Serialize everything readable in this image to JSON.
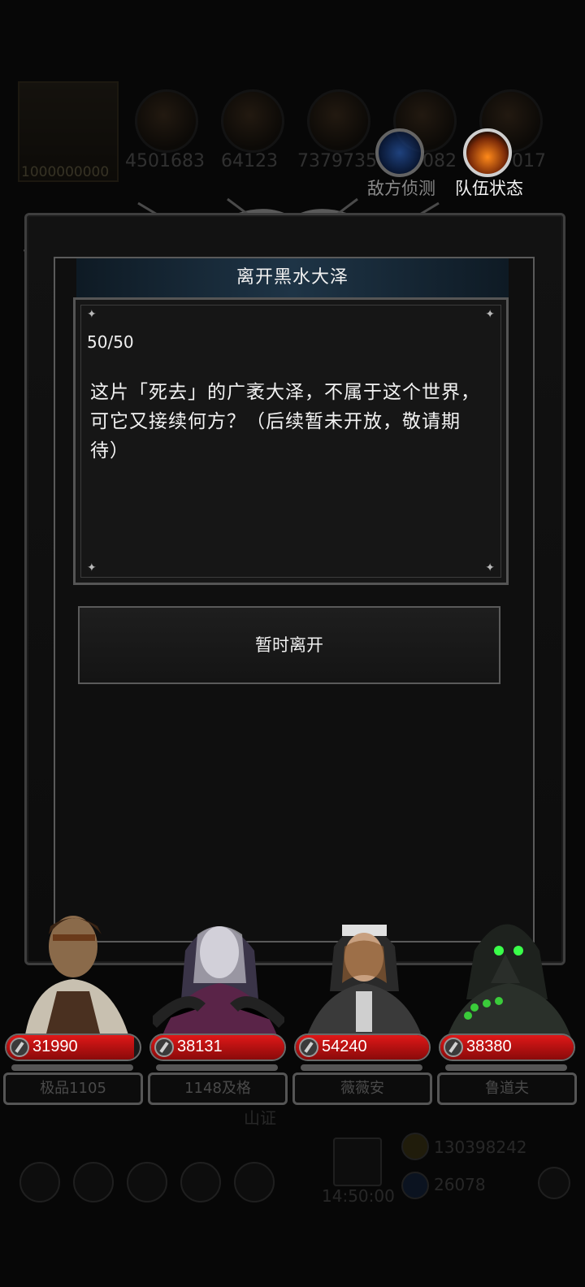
{
  "background": {
    "portrait_value": "1000000000",
    "resources": [
      "4501683",
      "64123",
      "7379735",
      "082",
      "017"
    ],
    "bottom": {
      "stamp": "山证",
      "gold": "130398242",
      "gems": "26078",
      "timer": "14:50:00"
    }
  },
  "hud": {
    "scout_label": "敌方侦测",
    "team_label": "队伍状态"
  },
  "dialog": {
    "title": "离开黑水大泽",
    "progress": "50/50",
    "description": "这片「死去」的广袤大泽，不属于这个世界，可它又接续何方？（后续暂未开放，敬请期待）",
    "leave_label": "暂时离开"
  },
  "heroes": [
    {
      "hp": "31990",
      "name": "极品1105",
      "hp_fill": 0.96
    },
    {
      "hp": "38131",
      "name": "1148及格",
      "hp_fill": 1.0
    },
    {
      "hp": "54240",
      "name": "薇薇安",
      "hp_fill": 1.0
    },
    {
      "hp": "38380",
      "name": "鲁道夫",
      "hp_fill": 1.0
    }
  ],
  "colors": {
    "hp_red": "#d01414",
    "title_bar": "#1e3446",
    "accent_fire": "#ff8a1a"
  }
}
